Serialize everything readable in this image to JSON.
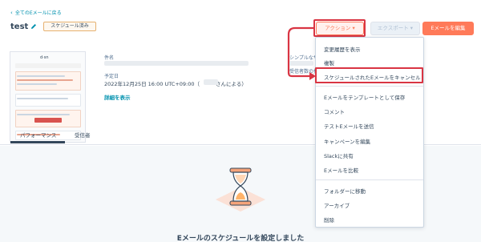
{
  "back_link": "全てのEメールに戻る",
  "title": "test",
  "status_badge": "スケジュール済み",
  "header_buttons": {
    "action": "アクション ▾",
    "export": "エクスポート ▾",
    "edit": "Eメールを編集"
  },
  "details": {
    "subject_label": "件名",
    "from_label": "シンプルなサ",
    "recipients_label": "受信者数の推",
    "scheduled_label": "予定日",
    "scheduled_value": "2022年12月25日 16:00 UTC+09:00（",
    "scheduled_by_suffix": "さんによる）",
    "details_link": "詳細を表示"
  },
  "thumbnail": {
    "logo": "d·sn"
  },
  "tabs": [
    "パフォーマンス",
    "受信者"
  ],
  "empty_state": {
    "title": "Eメールのスケジュールを設定しました"
  },
  "action_menu": {
    "items": [
      "変更履歴を表示",
      "複製",
      "スケジュールされたEメールをキャンセル",
      "Eメールをテンプレートとして保存",
      "コメント",
      "テストEメールを送信",
      "キャンペーンを編集",
      "Slackに共有",
      "Eメールを比較",
      "フォルダーに移動",
      "アーカイブ",
      "削除"
    ]
  },
  "colors": {
    "accent": "#ff7a59",
    "link": "#0091ae",
    "highlight": "#d93543",
    "text": "#33475b"
  }
}
